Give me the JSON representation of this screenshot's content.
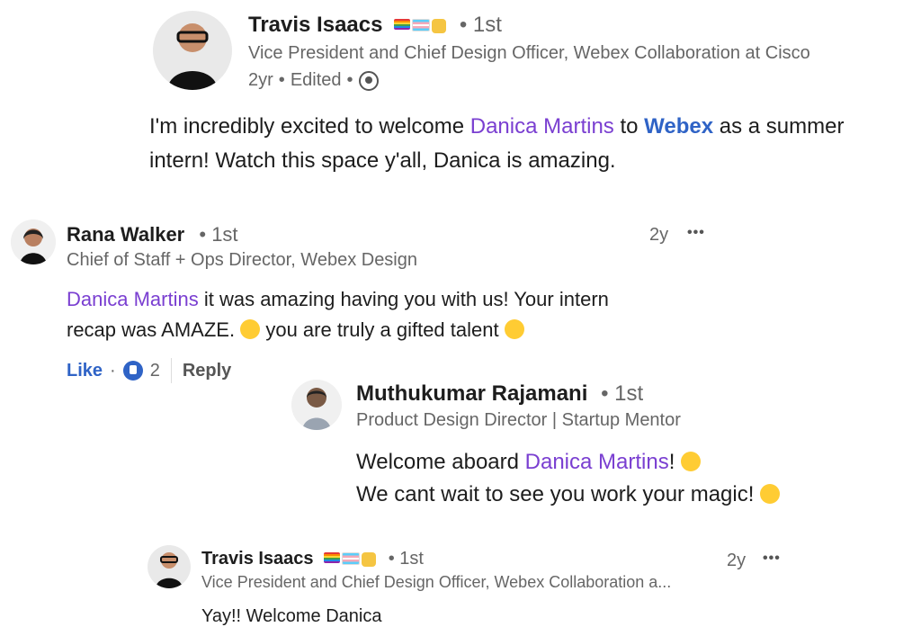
{
  "post": {
    "author": {
      "name": "Travis Isaacs",
      "degree": "• 1st",
      "title": "Vice President and Chief Design Officer, Webex Collaboration at Cisco",
      "time": "2yr",
      "edited": "Edited",
      "sep": "•"
    },
    "text": {
      "prefix": "I'm incredibly excited to welcome",
      "mention": "Danica Martins",
      "mid": "to",
      "company": "Webex",
      "suffix": "as a summer",
      "line2": "intern! Watch this space y'all, Danica is amazing."
    }
  },
  "comments": [
    {
      "name": "Rana Walker",
      "degree": "• 1st",
      "title": "Chief of Staff + Ops Director, Webex Design",
      "time": "2y",
      "more": "•••",
      "text": {
        "mention": "Danica Martins",
        "line1": "it was amazing having you with us! Your intern",
        "line2a": "recap was AMAZE.",
        "line2b": "you are truly a gifted talent"
      },
      "actions": {
        "like": "Like",
        "dot": "·",
        "count": "2",
        "reply": "Reply"
      }
    }
  ],
  "replies": [
    {
      "name": "Muthukumar Rajamani",
      "degree": "• 1st",
      "title": "Product Design Director | Startup Mentor",
      "text": {
        "prefix": "Welcome aboard",
        "mention": "Danica Martins",
        "suffix": "!",
        "line2": "We cant wait to see you work your magic!"
      }
    },
    {
      "name": "Travis Isaacs",
      "degree": "• 1st",
      "title": "Vice President and Chief Design Officer, Webex Collaboration a...",
      "time": "2y",
      "more": "•••",
      "text": "Yay!! Welcome Danica"
    }
  ],
  "icons": {
    "post_flags": [
      "pride-flag-icon",
      "trans-flag-icon",
      "raised-fist-icon"
    ],
    "globe": "globe-icon",
    "star-struck": "star-struck-emoji-icon",
    "party": "partying-face-emoji-icon",
    "confetti": "party-popper-emoji-icon",
    "smile": "grinning-face-emoji-icon",
    "like_reaction": "like-reaction-icon"
  }
}
